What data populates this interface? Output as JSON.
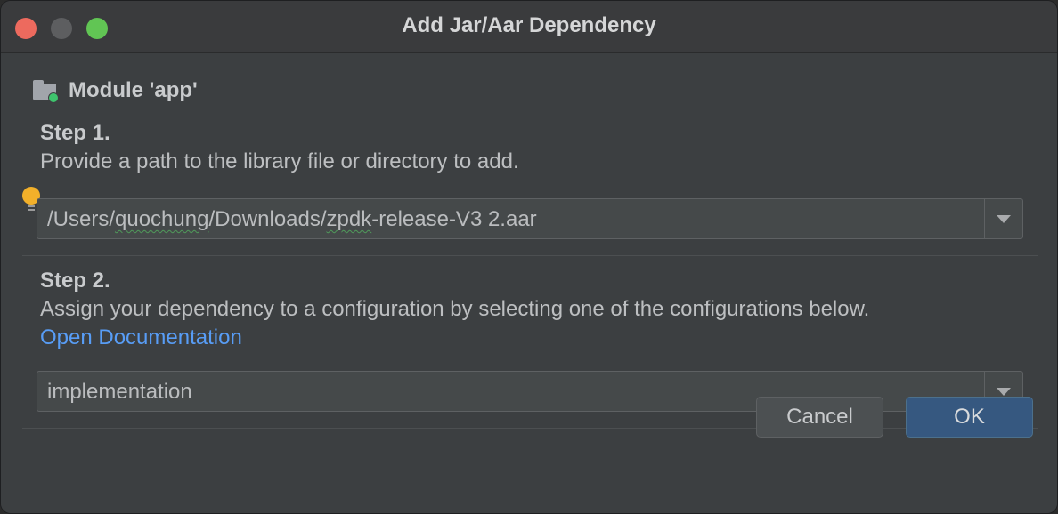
{
  "window": {
    "title": "Add Jar/Aar Dependency"
  },
  "module": {
    "label": "Module 'app'",
    "icon": "module-folder-icon"
  },
  "step1": {
    "heading": "Step 1.",
    "description": "Provide a path to the library file or directory to add.",
    "path_parts": [
      "/Users/",
      "quochung",
      "/Downloads/",
      "zpdk",
      "-release-V3 2.aar"
    ]
  },
  "step2": {
    "heading": "Step 2.",
    "description": "Assign your dependency to a configuration by selecting one of the configurations below.",
    "doc_link": "Open Documentation",
    "configuration": "implementation"
  },
  "buttons": {
    "cancel": "Cancel",
    "ok": "OK"
  },
  "colors": {
    "background": "#3c3f41",
    "link": "#589df6",
    "ok_button": "#365880",
    "close": "#ed6a5e",
    "maximize": "#61c554",
    "module_dot": "#3ec46d",
    "bulb": "#f2b02a"
  }
}
